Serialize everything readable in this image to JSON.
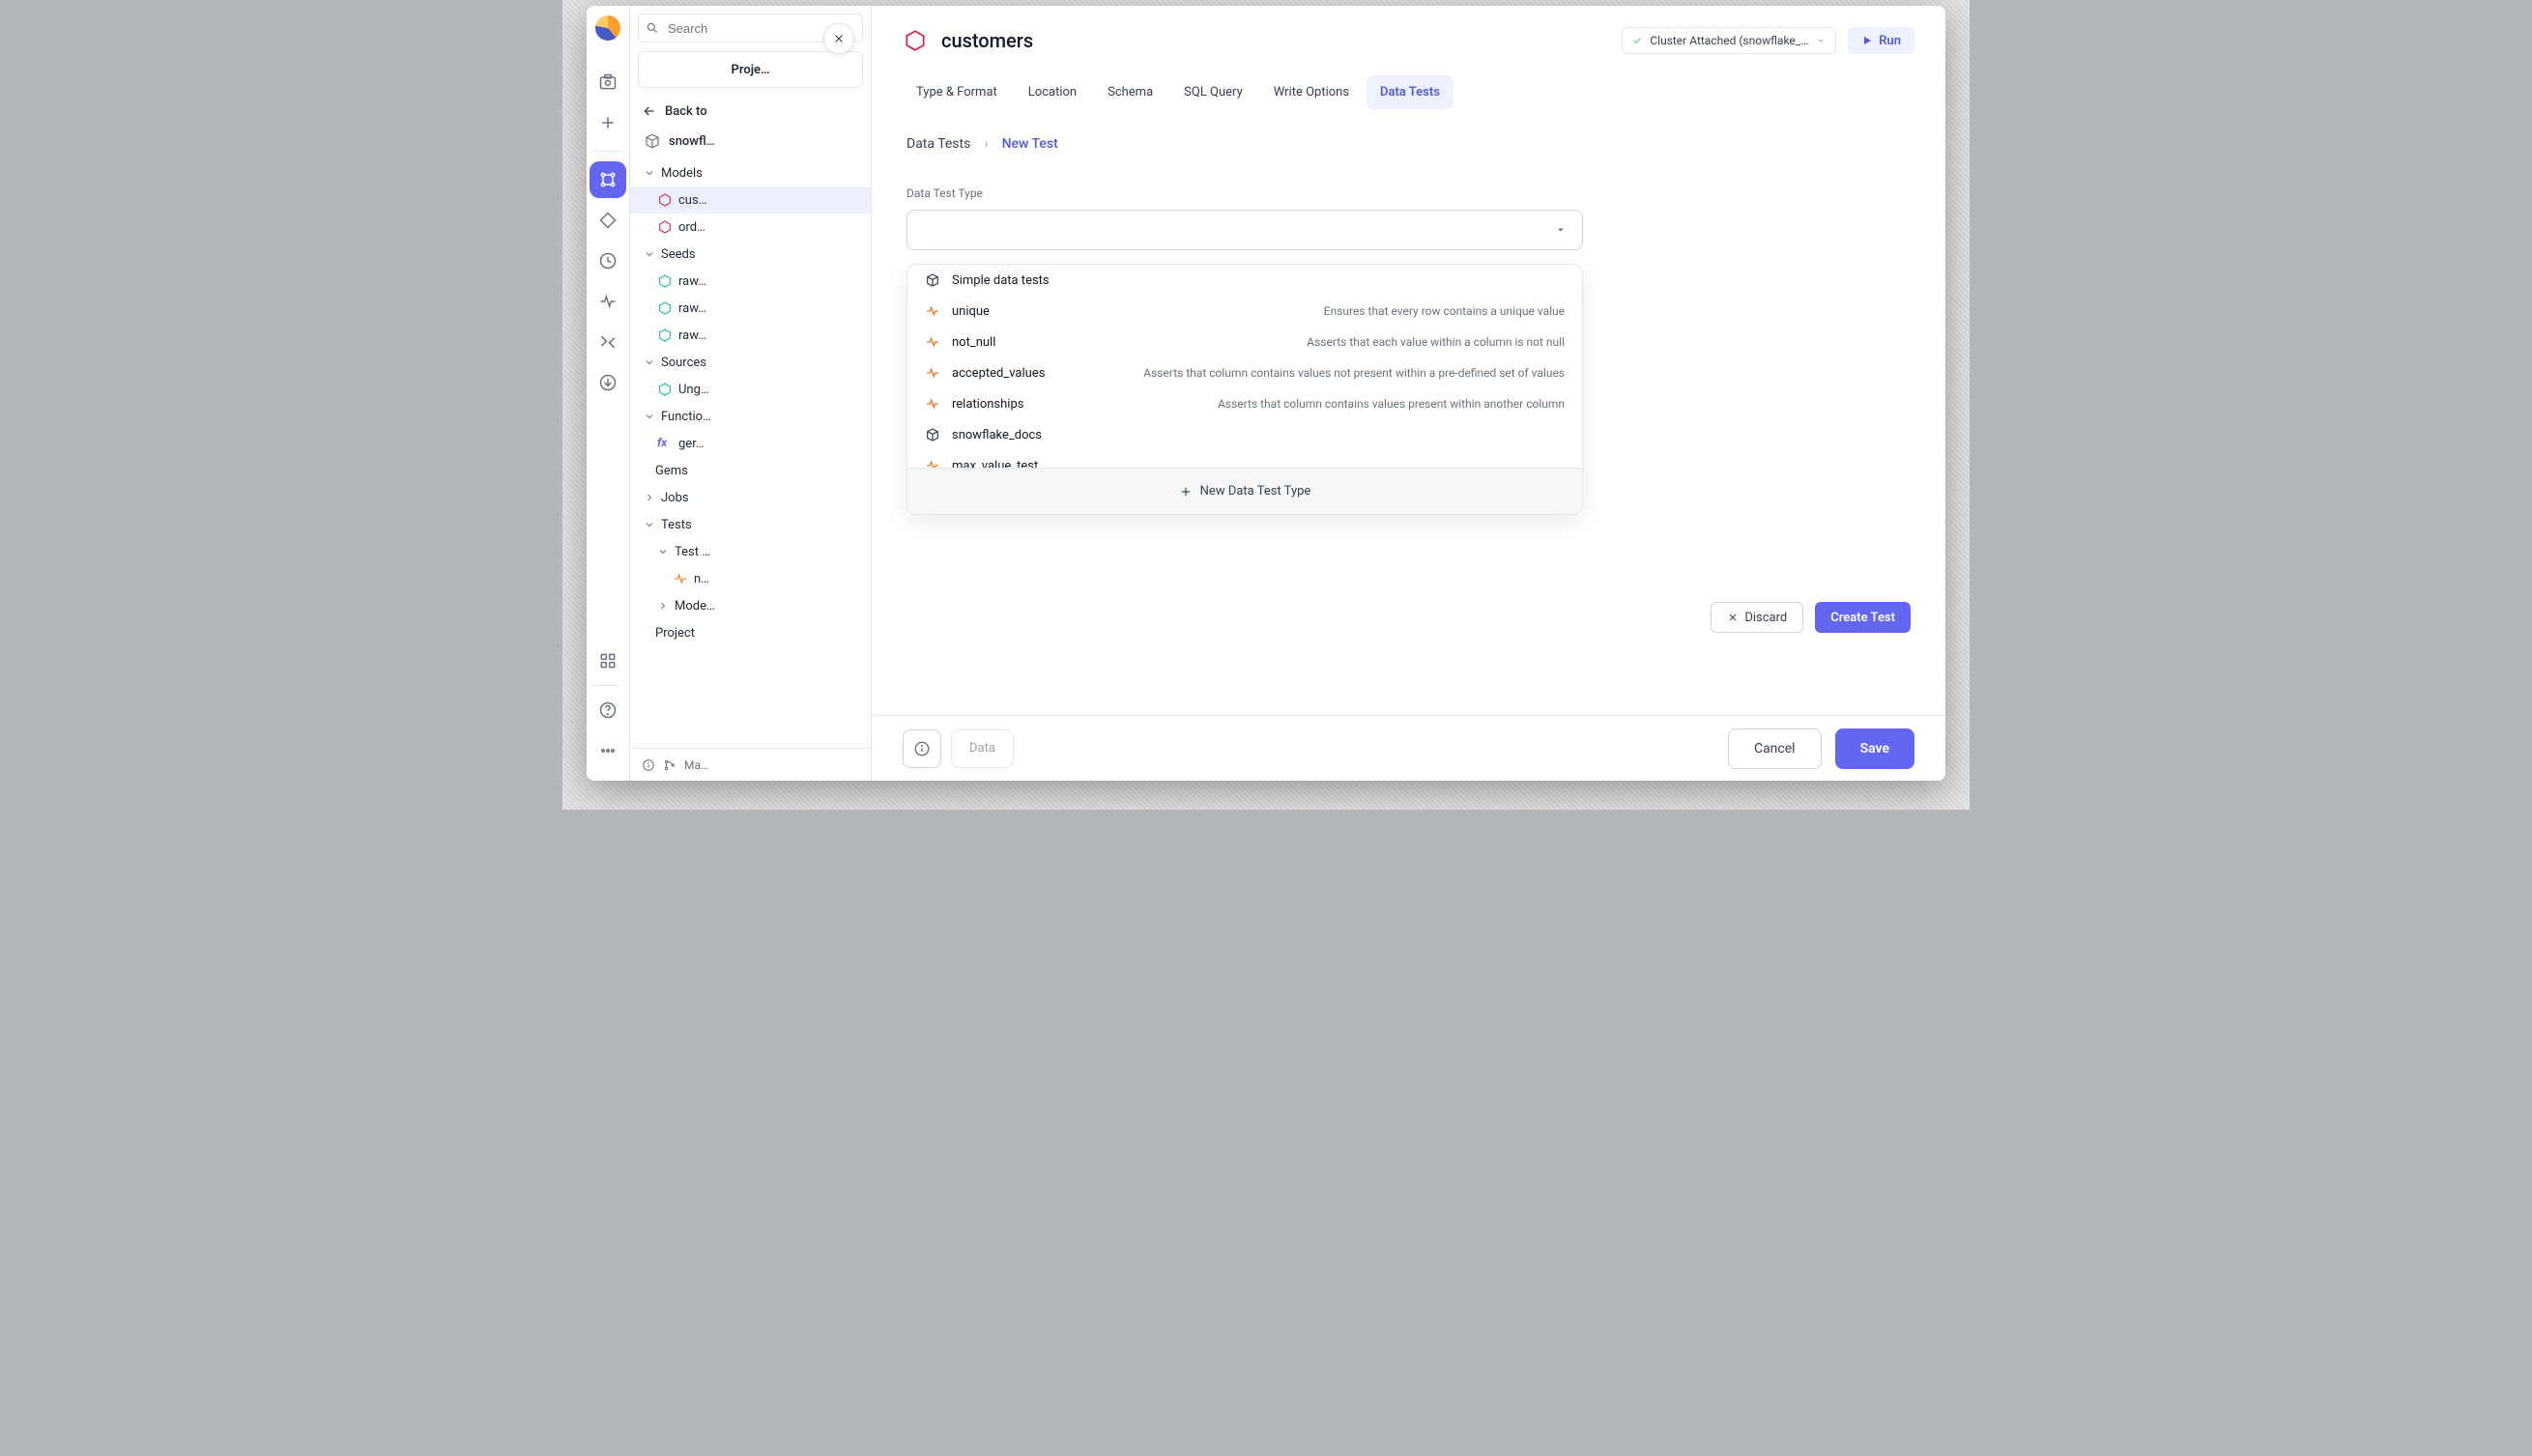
{
  "rail": {
    "tooltips": [
      "home",
      "add",
      "pipeline",
      "diamond",
      "history",
      "activity",
      "config",
      "download",
      "apps",
      "help",
      "more"
    ]
  },
  "sidebar": {
    "search_placeholder": "Search",
    "proj_header": "Proje…",
    "back_label": "Back to",
    "project_name": "snowfl…",
    "sections": {
      "models": "Models",
      "model_items": [
        "cus…",
        "ord…"
      ],
      "seeds": "Seeds",
      "seed_items": [
        "raw…",
        "raw…",
        "raw…"
      ],
      "sources": "Sources",
      "source_items": [
        "Ung…"
      ],
      "functions": "Functio…",
      "function_items": [
        "ger…"
      ],
      "gems": "Gems",
      "jobs": "Jobs",
      "tests": "Tests",
      "test_items": [
        "Test …"
      ],
      "test_subitems": [
        "n…"
      ],
      "mode": "Mode…",
      "project": "Project"
    },
    "footer": "Ma…"
  },
  "modal": {
    "title": "customers",
    "cluster_label": "Cluster Attached (snowflake_…",
    "run_label": "Run",
    "tabs": [
      "Type & Format",
      "Location",
      "Schema",
      "SQL Query",
      "Write Options",
      "Data Tests"
    ],
    "active_tab": 5,
    "crumbs": {
      "a": "Data Tests",
      "b": "New Test"
    },
    "field_label": "Data Test Type",
    "dropdown": {
      "options": [
        {
          "type": "group",
          "name": "Simple data tests"
        },
        {
          "type": "test",
          "name": "unique",
          "desc": "Ensures that every row contains a unique value"
        },
        {
          "type": "test",
          "name": "not_null",
          "desc": "Asserts that each value within a column is not null"
        },
        {
          "type": "test",
          "name": "accepted_values",
          "desc": "Asserts that column contains values not present within a pre-defined set of values"
        },
        {
          "type": "test",
          "name": "relationships",
          "desc": "Asserts that column contains values present within another column"
        },
        {
          "type": "group",
          "name": "snowflake_docs"
        },
        {
          "type": "test",
          "name": "max_value_test"
        }
      ],
      "footer": "New Data Test Type"
    },
    "discard": "Discard",
    "create": "Create Test",
    "cancel": "Cancel",
    "save": "Save",
    "data_pill": "Data"
  }
}
